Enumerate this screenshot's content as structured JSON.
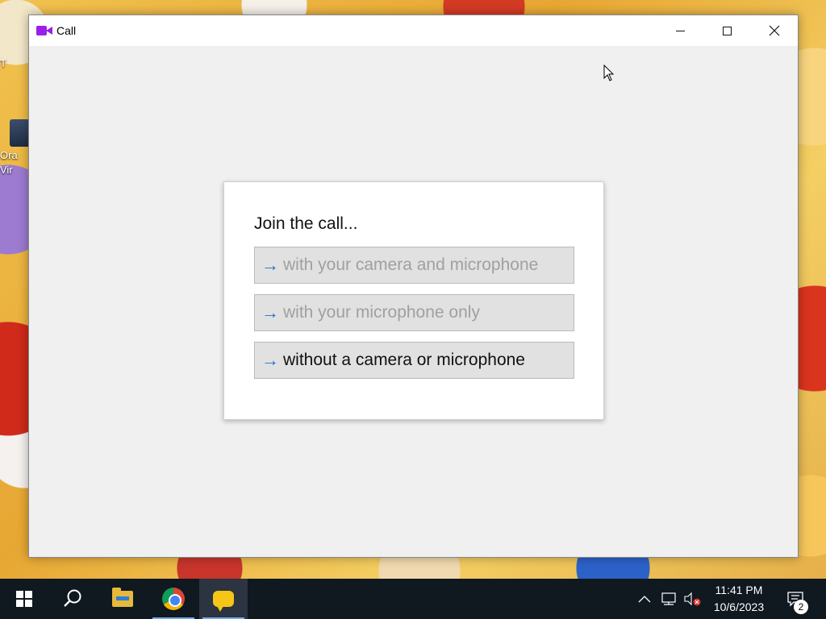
{
  "window": {
    "title": "Call",
    "app_icon": "video-camera-icon",
    "controls": {
      "minimize": "minimize-icon",
      "maximize": "maximize-icon",
      "close": "close-icon"
    }
  },
  "dialog": {
    "title": "Join the call...",
    "options": [
      {
        "label": "with your camera and microphone",
        "enabled": false,
        "icon": "arrow-right-icon"
      },
      {
        "label": "with your microphone only",
        "enabled": false,
        "icon": "arrow-right-icon"
      },
      {
        "label": "without a camera or microphone",
        "enabled": true,
        "icon": "arrow-right-icon"
      }
    ],
    "arrow_color": "#1a73c9"
  },
  "desktop": {
    "icons": [
      {
        "label": "T"
      },
      {
        "label": "Ora Vir"
      }
    ]
  },
  "taskbar": {
    "apps": [
      "start-icon",
      "search-icon",
      "file-explorer-icon",
      "chrome-icon",
      "chat-app-icon"
    ],
    "tray": {
      "clock_time": "11:41 PM",
      "clock_date": "10/6/2023",
      "notification_count": "2"
    }
  },
  "colors": {
    "app_accent": "#9b1fe8",
    "taskbar_bg": "#101820"
  }
}
